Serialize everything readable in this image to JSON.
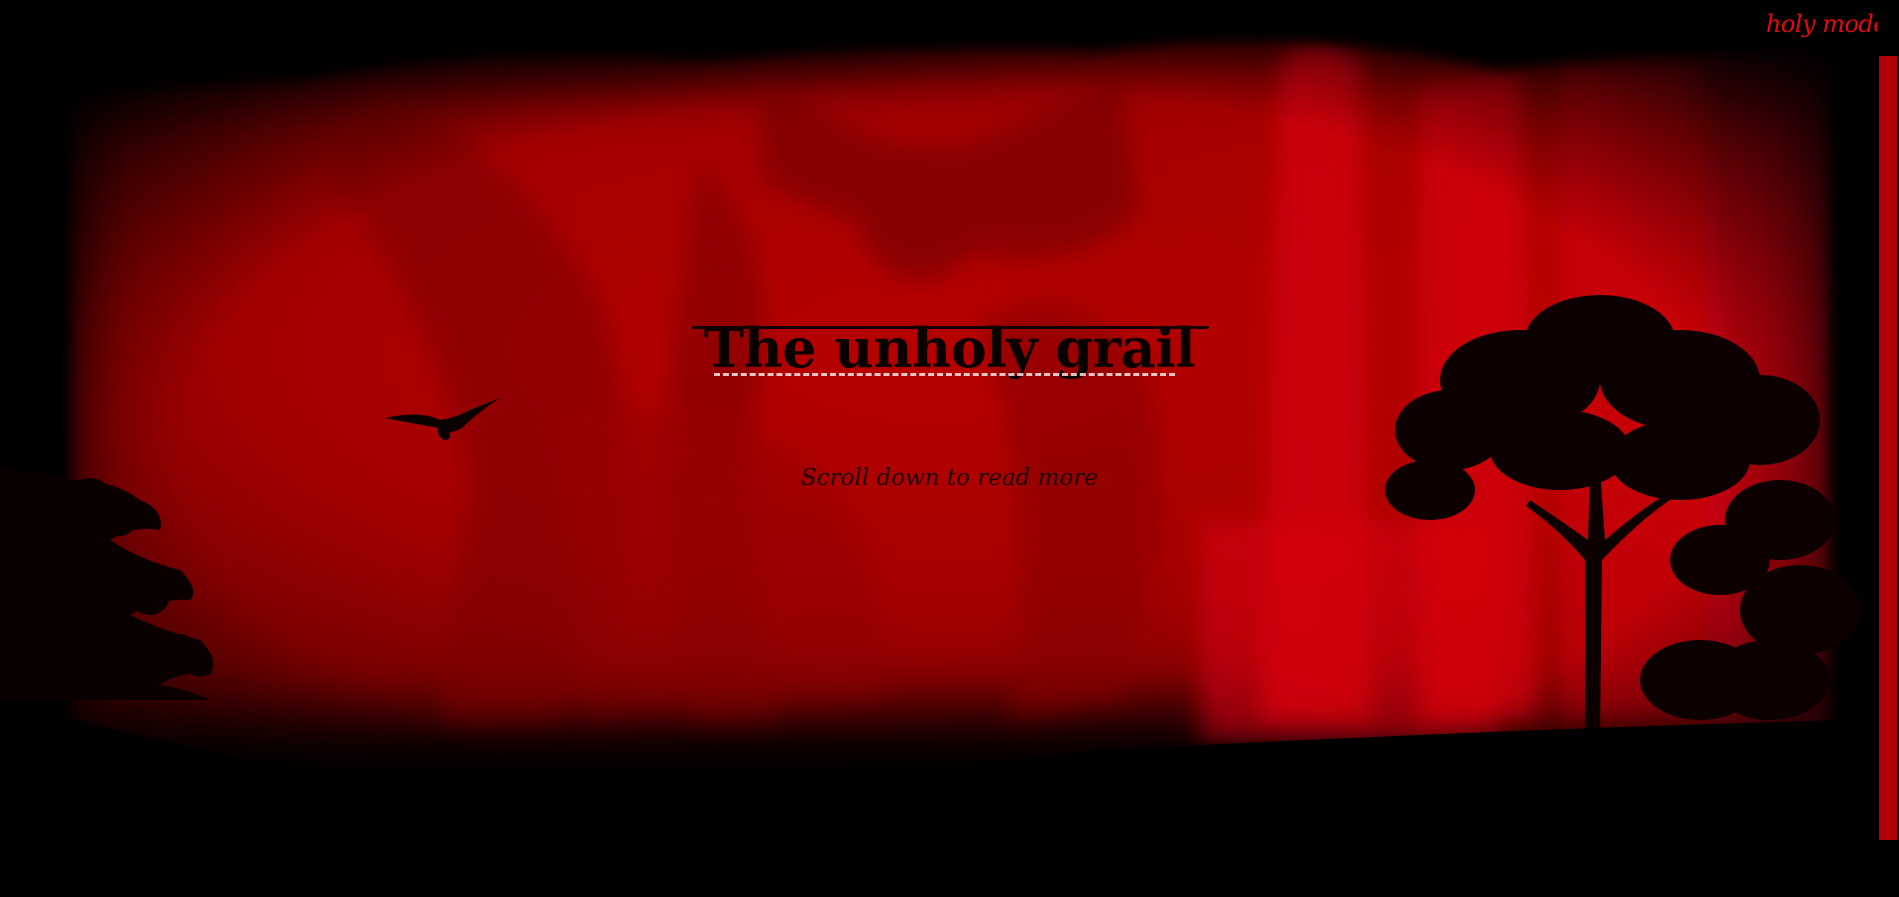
{
  "header": {
    "mode_toggle_label": "holy mode"
  },
  "hero": {
    "title": "The unholy grail",
    "subtitle": "Scroll down to read more"
  },
  "colors": {
    "accent": "#e8070c",
    "background": "#000000",
    "scene_red": "#c40007",
    "silhouette": "#0a0000"
  },
  "icons": {
    "bird": "bird-silhouette-icon"
  }
}
